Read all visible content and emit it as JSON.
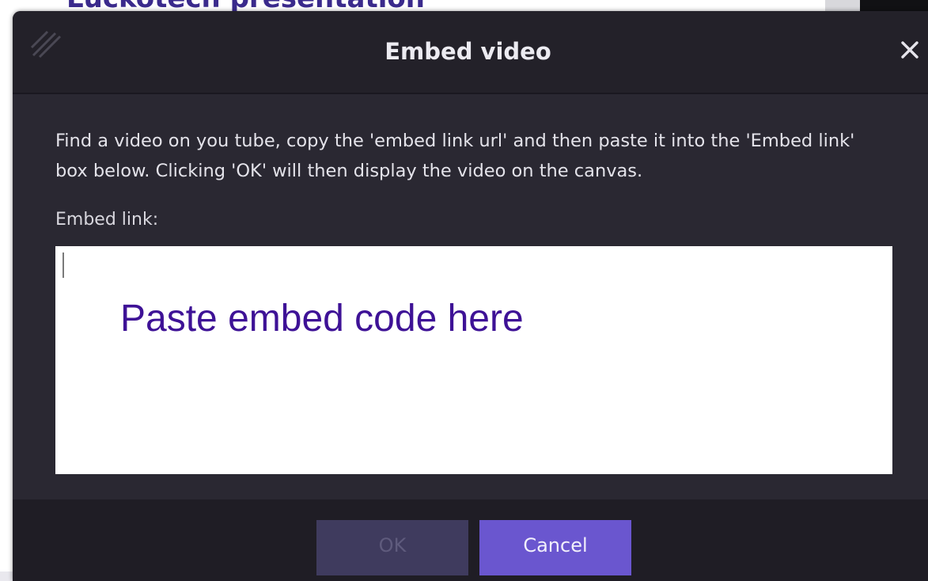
{
  "background": {
    "presentation_title": "Lückotech presentation"
  },
  "dialog": {
    "title": "Embed video",
    "close_icon": "close-icon",
    "drag_icon": "drag-handle-icon",
    "instructions": "Find a video on you tube, copy the 'embed link url' and then paste it into the 'Embed link' box below. Clicking 'OK' will then display the video on the canvas.",
    "embed_label": "Embed link:",
    "embed_value": "",
    "placeholder": "Paste embed code here",
    "ok_label": "OK",
    "ok_disabled": true,
    "cancel_label": "Cancel"
  },
  "colors": {
    "accent": "#6a56cf",
    "placeholder_text": "#3e1296",
    "dialog_bg": "#26242e"
  }
}
